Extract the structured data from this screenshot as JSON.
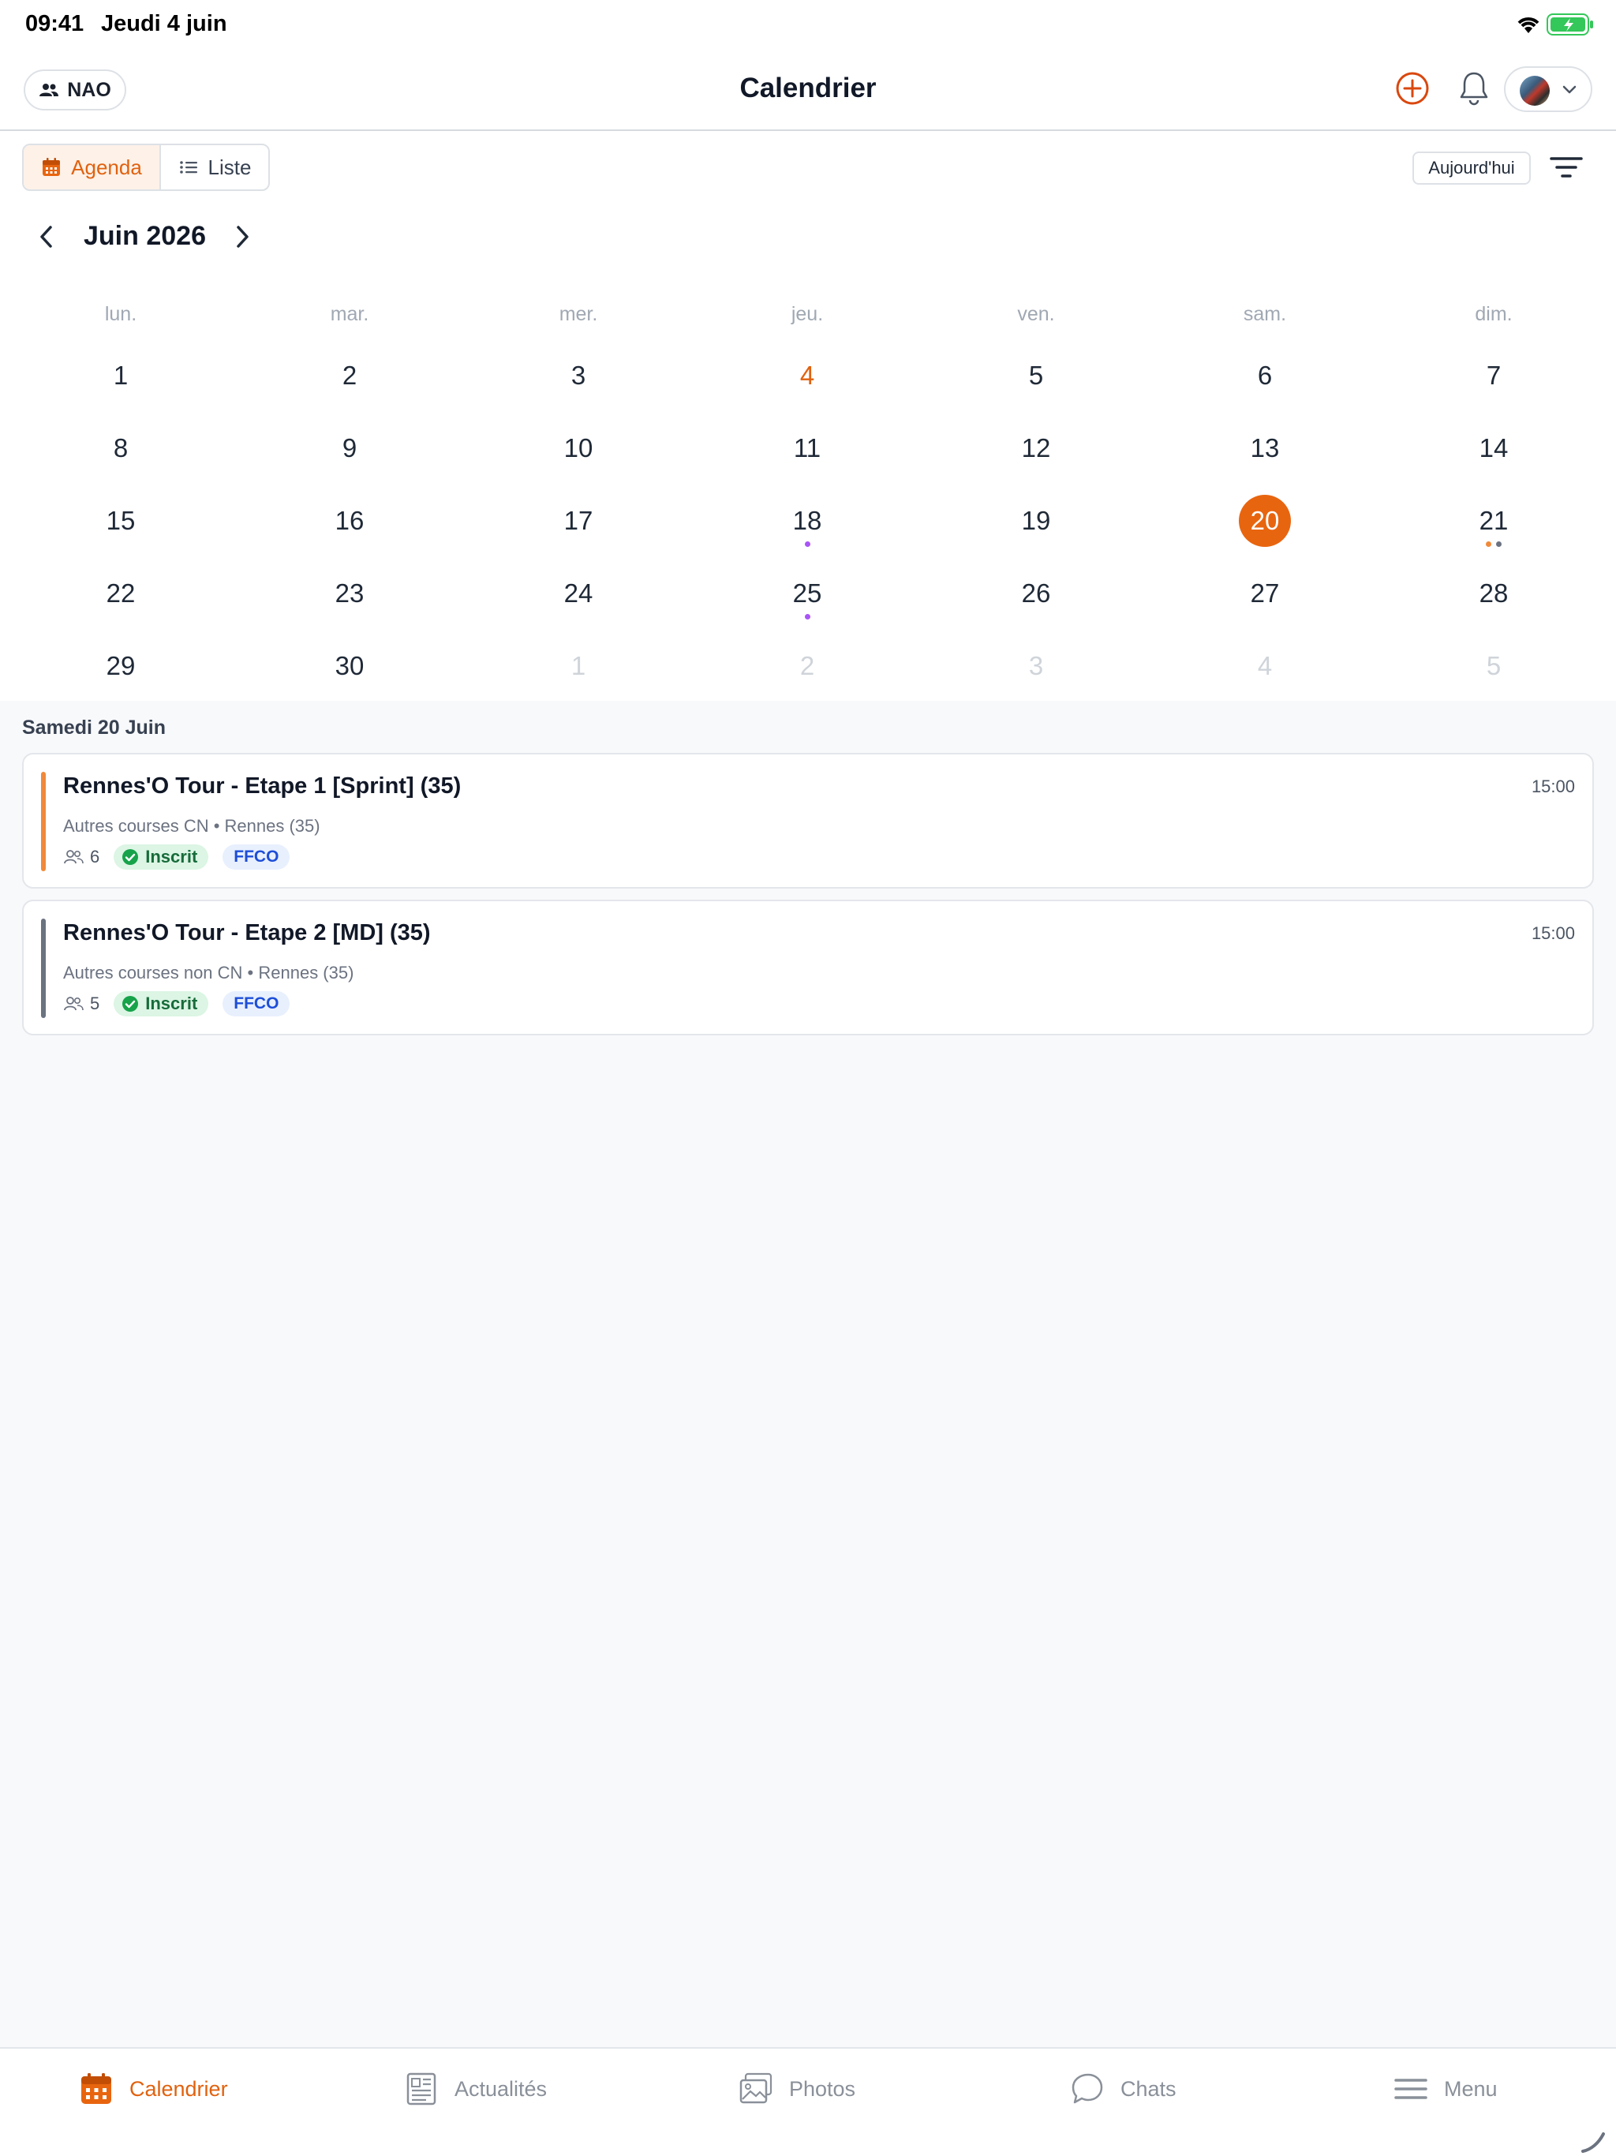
{
  "status_bar": {
    "time": "09:41",
    "date": "Jeudi 4 juin"
  },
  "header": {
    "group_label": "NAO",
    "title": "Calendrier"
  },
  "toolbar": {
    "agenda_label": "Agenda",
    "list_label": "Liste",
    "today_label": "Aujourd'hui"
  },
  "calendar": {
    "month_title": "Juin 2026",
    "weekdays": [
      "lun.",
      "mar.",
      "mer.",
      "jeu.",
      "ven.",
      "sam.",
      "dim."
    ],
    "weeks": [
      [
        {
          "n": "1"
        },
        {
          "n": "2"
        },
        {
          "n": "3"
        },
        {
          "n": "4",
          "today": true
        },
        {
          "n": "5"
        },
        {
          "n": "6"
        },
        {
          "n": "7"
        }
      ],
      [
        {
          "n": "8"
        },
        {
          "n": "9"
        },
        {
          "n": "10"
        },
        {
          "n": "11"
        },
        {
          "n": "12"
        },
        {
          "n": "13"
        },
        {
          "n": "14"
        }
      ],
      [
        {
          "n": "15"
        },
        {
          "n": "16"
        },
        {
          "n": "17"
        },
        {
          "n": "18",
          "dots": [
            "#a855f7"
          ]
        },
        {
          "n": "19"
        },
        {
          "n": "20",
          "selected": true,
          "dots": [
            "#f08a3a"
          ]
        },
        {
          "n": "21",
          "dots": [
            "#f08a3a",
            "#6b7280"
          ]
        }
      ],
      [
        {
          "n": "22"
        },
        {
          "n": "23"
        },
        {
          "n": "24"
        },
        {
          "n": "25",
          "dots": [
            "#a855f7"
          ]
        },
        {
          "n": "26"
        },
        {
          "n": "27"
        },
        {
          "n": "28"
        }
      ],
      [
        {
          "n": "29"
        },
        {
          "n": "30"
        },
        {
          "n": "1",
          "muted": true
        },
        {
          "n": "2",
          "muted": true
        },
        {
          "n": "3",
          "muted": true
        },
        {
          "n": "4",
          "muted": true
        },
        {
          "n": "5",
          "muted": true
        }
      ]
    ]
  },
  "selected_day": {
    "heading": "Samedi 20 Juin",
    "events": [
      {
        "title": "Rennes'O Tour - Etape 1 [Sprint] (35)",
        "subtitle": "Autres courses CN • Rennes (35)",
        "time": "15:00",
        "participants": "6",
        "status": "Inscrit",
        "tag": "FFCO",
        "color": "#f08a3a"
      },
      {
        "title": "Rennes'O Tour - Etape 2 [MD] (35)",
        "subtitle": "Autres courses non CN • Rennes (35)",
        "time": "15:00",
        "participants": "5",
        "status": "Inscrit",
        "tag": "FFCO",
        "color": "#6b7280"
      }
    ]
  },
  "tabbar": {
    "items": [
      {
        "label": "Calendrier",
        "icon": "calendar-icon",
        "active": true
      },
      {
        "label": "Actualités",
        "icon": "newspaper-icon"
      },
      {
        "label": "Photos",
        "icon": "photos-icon"
      },
      {
        "label": "Chats",
        "icon": "chat-icon"
      },
      {
        "label": "Menu",
        "icon": "menu-icon"
      }
    ]
  },
  "colors": {
    "accent": "#e8650f",
    "inscrit_bg": "#dcf5e4",
    "ffco_bg": "#e8f0fe"
  }
}
